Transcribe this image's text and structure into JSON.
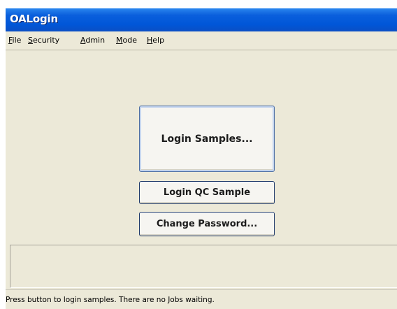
{
  "window": {
    "title": "OALogin"
  },
  "menu": {
    "items": [
      {
        "underline": "F",
        "rest": "ile"
      },
      {
        "underline": "S",
        "rest": "ecurity"
      },
      {
        "underline": "A",
        "rest": "dmin"
      },
      {
        "underline": "M",
        "rest": "ode"
      },
      {
        "underline": "H",
        "rest": "elp"
      }
    ]
  },
  "buttons": {
    "login_samples": "Login Samples...",
    "login_qc": "Login QC Sample",
    "change_password": "Change Password..."
  },
  "status": {
    "text": "Press button to login samples. There are no Jobs waiting."
  }
}
